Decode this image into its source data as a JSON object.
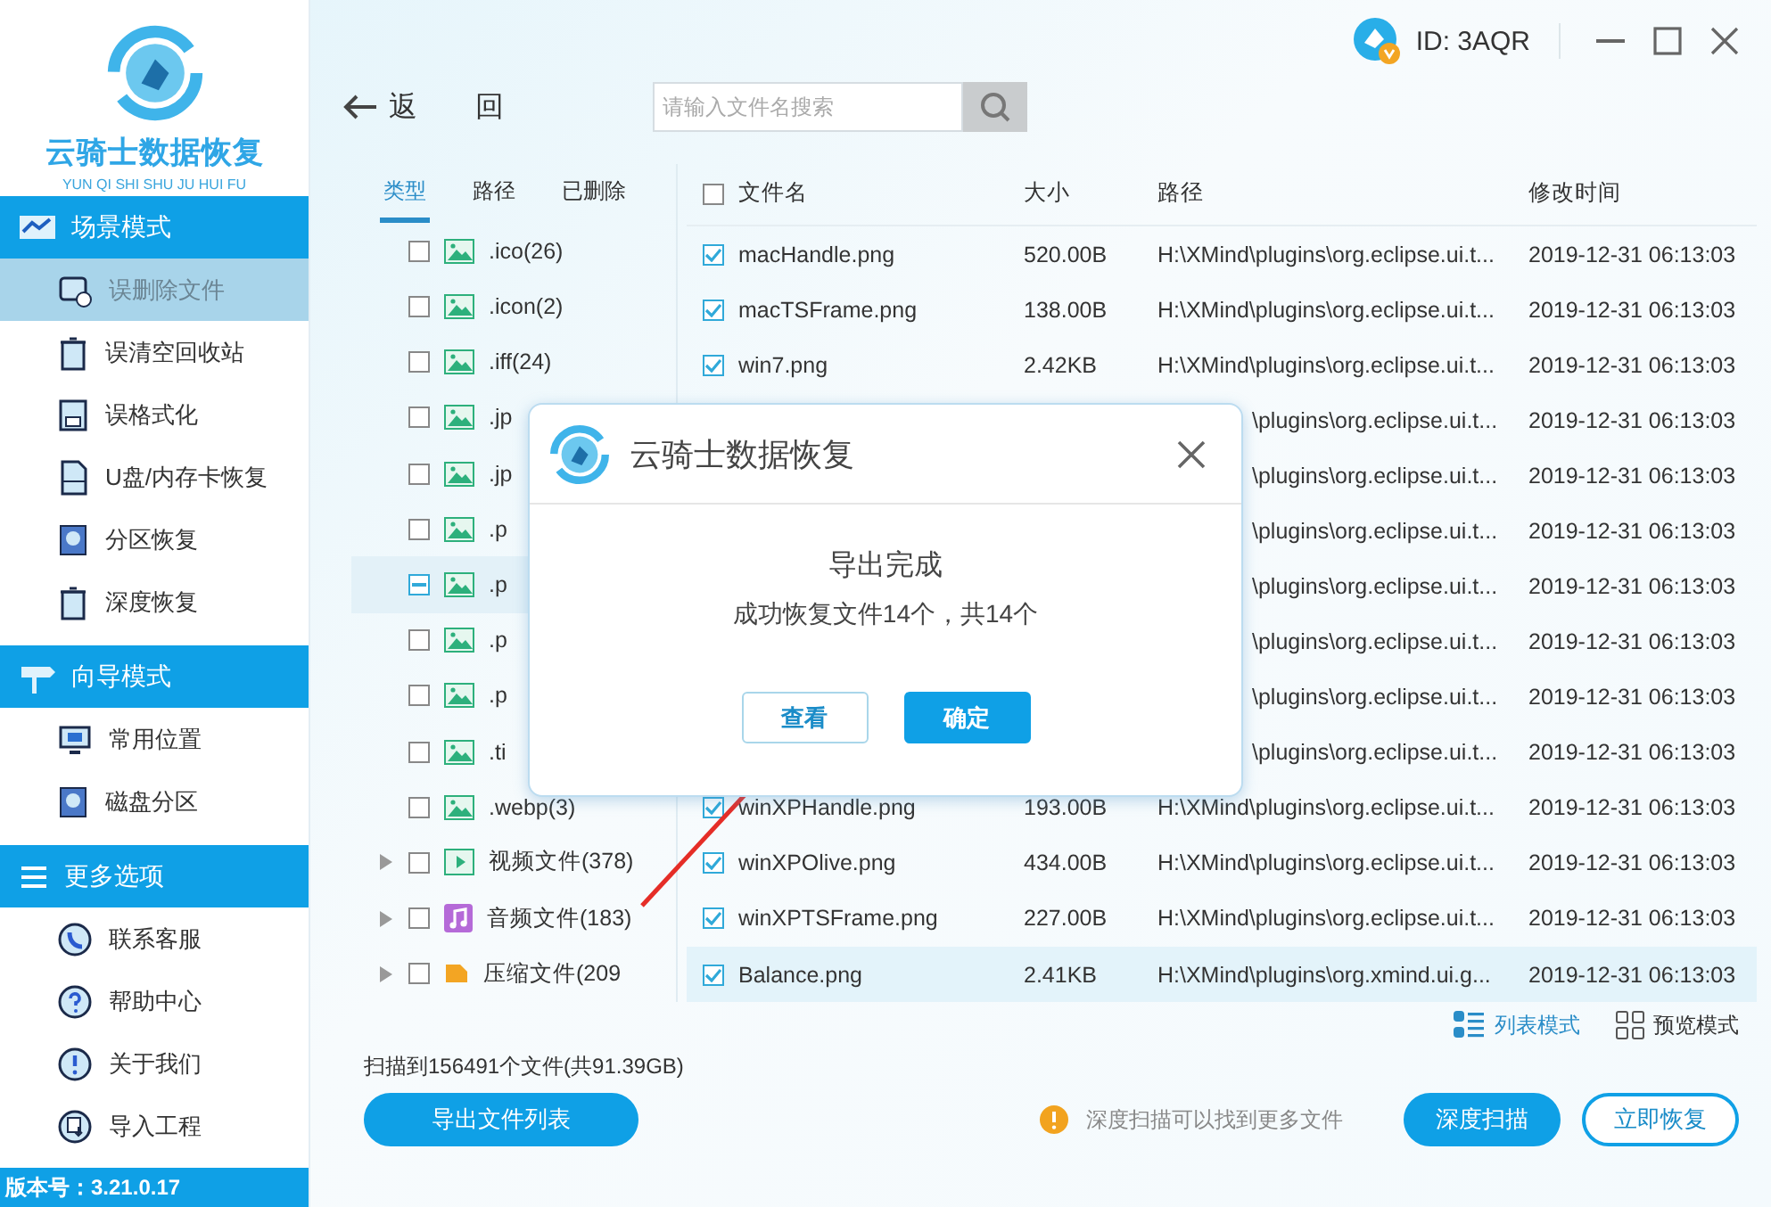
{
  "brand": {
    "title": "云骑士数据恢复",
    "subtitle": "YUN QI SHI SHU JU HUI FU"
  },
  "account": {
    "id": "ID: 3AQR"
  },
  "sidebar": {
    "sections": [
      {
        "title": "场景模式",
        "kind": "scene",
        "items": [
          {
            "label": "误删除文件",
            "kind": "file",
            "selected": true
          },
          {
            "label": "误清空回收站",
            "kind": "bin",
            "selected": false
          },
          {
            "label": "误格式化",
            "kind": "floppy",
            "selected": false
          },
          {
            "label": "U盘/内存卡恢复",
            "kind": "card",
            "selected": false
          },
          {
            "label": "分区恢复",
            "kind": "disk",
            "selected": false
          },
          {
            "label": "深度恢复",
            "kind": "bin",
            "selected": false
          }
        ]
      },
      {
        "title": "向导模式",
        "kind": "sign",
        "items": [
          {
            "label": "常用位置",
            "kind": "monitor",
            "selected": false
          },
          {
            "label": "磁盘分区",
            "kind": "disk",
            "selected": false
          }
        ]
      },
      {
        "title": "更多选项",
        "kind": "menu",
        "items": [
          {
            "label": "联系客服",
            "kind": "phone",
            "selected": false
          },
          {
            "label": "帮助中心",
            "kind": "help",
            "selected": false
          },
          {
            "label": "关于我们",
            "kind": "info",
            "selected": false
          },
          {
            "label": "导入工程",
            "kind": "import",
            "selected": false
          }
        ]
      }
    ],
    "version": "版本号：3.21.0.17"
  },
  "back": {
    "label": "返 回"
  },
  "search": {
    "placeholder": "请输入文件名搜索"
  },
  "filter_tabs": [
    {
      "label": "类型",
      "selected": true
    },
    {
      "label": "路径",
      "selected": false
    },
    {
      "label": "已删除",
      "selected": false
    }
  ],
  "types": [
    {
      "label": ".ico(26)",
      "kind": "image",
      "checked": false,
      "indeterminate": false,
      "selected": false,
      "expandable": false
    },
    {
      "label": ".icon(2)",
      "kind": "image",
      "checked": false,
      "indeterminate": false,
      "selected": false,
      "expandable": false
    },
    {
      "label": ".iff(24)",
      "kind": "image",
      "checked": false,
      "indeterminate": false,
      "selected": false,
      "expandable": false
    },
    {
      "label": ".jp",
      "kind": "image",
      "checked": false,
      "indeterminate": false,
      "selected": false,
      "expandable": false
    },
    {
      "label": ".jp",
      "kind": "image",
      "checked": false,
      "indeterminate": false,
      "selected": false,
      "expandable": false
    },
    {
      "label": ".p",
      "kind": "image",
      "checked": false,
      "indeterminate": false,
      "selected": false,
      "expandable": false
    },
    {
      "label": ".p",
      "kind": "image",
      "checked": false,
      "indeterminate": true,
      "selected": true,
      "expandable": false
    },
    {
      "label": ".p",
      "kind": "image",
      "checked": false,
      "indeterminate": false,
      "selected": false,
      "expandable": false
    },
    {
      "label": ".p",
      "kind": "image",
      "checked": false,
      "indeterminate": false,
      "selected": false,
      "expandable": false
    },
    {
      "label": ".ti",
      "kind": "image",
      "checked": false,
      "indeterminate": false,
      "selected": false,
      "expandable": false
    },
    {
      "label": ".webp(3)",
      "kind": "image",
      "checked": false,
      "indeterminate": false,
      "selected": false,
      "expandable": false
    },
    {
      "label": "视频文件(378)",
      "kind": "video",
      "checked": false,
      "indeterminate": false,
      "selected": false,
      "expandable": true
    },
    {
      "label": "音频文件(183)",
      "kind": "audio",
      "checked": false,
      "indeterminate": false,
      "selected": false,
      "expandable": true
    },
    {
      "label": "压缩文件(209",
      "kind": "archive",
      "checked": false,
      "indeterminate": false,
      "selected": false,
      "expandable": true
    }
  ],
  "table": {
    "columns": [
      "文件名",
      "大小",
      "路径",
      "修改时间"
    ],
    "all_checked": false,
    "rows": [
      {
        "kind": "full",
        "name": "macHandle.png",
        "size": "520.00B",
        "path": "H:\\XMind\\plugins\\org.eclipse.ui.t...",
        "date": "2019-12-31 06:13:03",
        "checked": true,
        "selected": false
      },
      {
        "kind": "full",
        "name": "macTSFrame.png",
        "size": "138.00B",
        "path": "H:\\XMind\\plugins\\org.eclipse.ui.t...",
        "date": "2019-12-31 06:13:03",
        "checked": true,
        "selected": false
      },
      {
        "kind": "full",
        "name": "win7.png",
        "size": "2.42KB",
        "path": "H:\\XMind\\plugins\\org.eclipse.ui.t...",
        "date": "2019-12-31 06:13:03",
        "checked": true,
        "selected": false
      },
      {
        "kind": "covered",
        "path": "\\plugins\\org.eclipse.ui.t...",
        "date": "2019-12-31 06:13:03"
      },
      {
        "kind": "covered",
        "path": "\\plugins\\org.eclipse.ui.t...",
        "date": "2019-12-31 06:13:03"
      },
      {
        "kind": "covered",
        "path": "\\plugins\\org.eclipse.ui.t...",
        "date": "2019-12-31 06:13:03"
      },
      {
        "kind": "covered",
        "path": "\\plugins\\org.eclipse.ui.t...",
        "date": "2019-12-31 06:13:03"
      },
      {
        "kind": "covered",
        "path": "\\plugins\\org.eclipse.ui.t...",
        "date": "2019-12-31 06:13:03"
      },
      {
        "kind": "covered",
        "path": "\\plugins\\org.eclipse.ui.t...",
        "date": "2019-12-31 06:13:03"
      },
      {
        "kind": "covered",
        "path": "\\plugins\\org.eclipse.ui.t...",
        "date": "2019-12-31 06:13:03"
      },
      {
        "kind": "full",
        "name": "winXPHandle.png",
        "size": "193.00B",
        "path": "H:\\XMind\\plugins\\org.eclipse.ui.t...",
        "date": "2019-12-31 06:13:03",
        "checked": true,
        "selected": false
      },
      {
        "kind": "full",
        "name": "winXPOlive.png",
        "size": "434.00B",
        "path": "H:\\XMind\\plugins\\org.eclipse.ui.t...",
        "date": "2019-12-31 06:13:03",
        "checked": true,
        "selected": false
      },
      {
        "kind": "full",
        "name": "winXPTSFrame.png",
        "size": "227.00B",
        "path": "H:\\XMind\\plugins\\org.eclipse.ui.t...",
        "date": "2019-12-31 06:13:03",
        "checked": true,
        "selected": false
      },
      {
        "kind": "full",
        "name": "Balance.png",
        "size": "2.41KB",
        "path": "H:\\XMind\\plugins\\org.xmind.ui.g...",
        "date": "2019-12-31 06:13:03",
        "checked": true,
        "selected": true
      }
    ]
  },
  "view_modes": [
    {
      "label": "列表模式",
      "kind": "list",
      "selected": true
    },
    {
      "label": "预览模式",
      "kind": "grid",
      "selected": false
    }
  ],
  "scan_summary": "扫描到156491个文件(共91.39GB)",
  "export_button": "导出文件列表",
  "hint": "深度扫描可以找到更多文件",
  "actions": [
    {
      "label": "深度扫描",
      "kind": "primary"
    },
    {
      "label": "立即恢复",
      "kind": "outline"
    }
  ],
  "dialog": {
    "title": "云骑士数据恢复",
    "heading": "导出完成",
    "message": "成功恢复文件14个，共14个",
    "buttons": [
      {
        "label": "查看",
        "kind": "outline"
      },
      {
        "label": "确定",
        "kind": "primary"
      }
    ]
  }
}
